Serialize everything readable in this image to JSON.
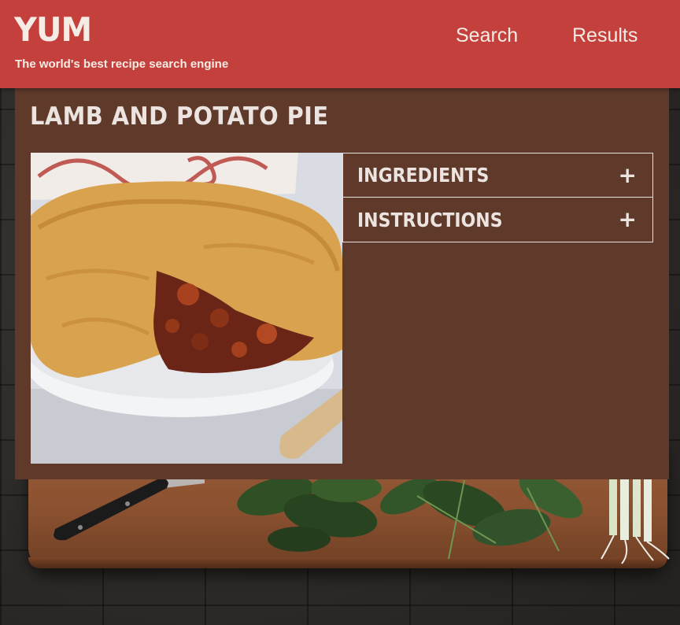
{
  "app": {
    "logo": "YUM",
    "tagline": "The world's best recipe search engine"
  },
  "nav": {
    "search_label": "Search",
    "results_label": "Results"
  },
  "recipe": {
    "title": "LAMB AND POTATO PIE",
    "image_icon": "pie-photo",
    "sections": [
      {
        "label": "INGREDIENTS",
        "icon": "plus-icon",
        "expanded": false
      },
      {
        "label": "INSTRUCTIONS",
        "icon": "plus-icon",
        "expanded": false
      }
    ]
  },
  "colors": {
    "header": "#c4403d",
    "panel": "#5f3a2b",
    "text_light": "#ece4e0"
  }
}
